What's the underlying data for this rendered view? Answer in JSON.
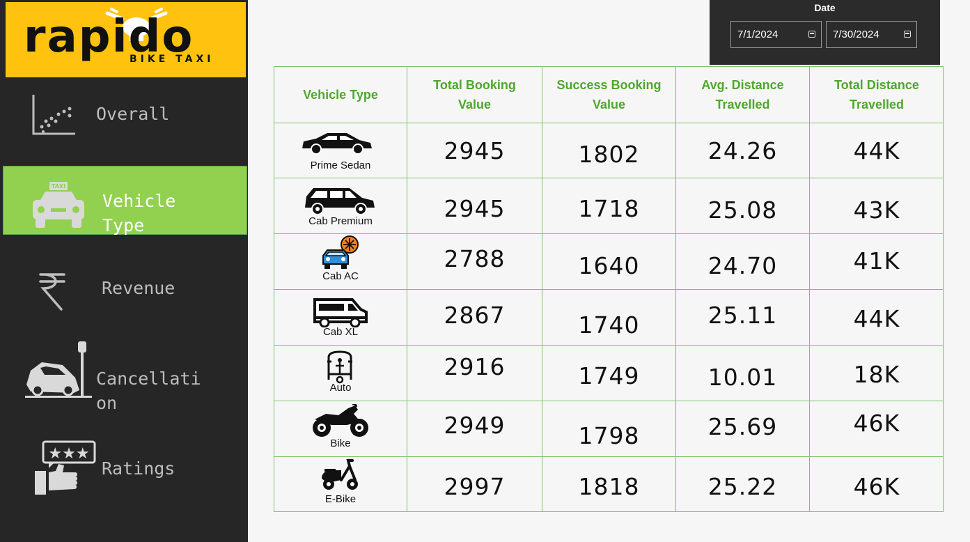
{
  "brand": {
    "name": "rapido",
    "tagline": "BIKE TAXI"
  },
  "sidebar": {
    "items": [
      {
        "label": "Overall",
        "icon": "scatter-chart-icon"
      },
      {
        "label_line1": "Vehicle",
        "label_line2": "Type",
        "icon": "taxi-icon",
        "active": true
      },
      {
        "label": "Revenue",
        "icon": "rupee-icon"
      },
      {
        "label_line1": "Cancellati",
        "label_line2": "on",
        "icon": "car-crash-icon"
      },
      {
        "label": "Ratings",
        "icon": "thumbs-up-stars-icon"
      }
    ]
  },
  "date_filter": {
    "title": "Date",
    "start": "7/1/2024",
    "end": "7/30/2024"
  },
  "table": {
    "headers": {
      "vehicle_type": "Vehicle Type",
      "total_booking_line1": "Total Booking",
      "total_booking_line2": "Value",
      "success_booking_line1": "Success Booking",
      "success_booking_line2": "Value",
      "avg_distance_line1": "Avg. Distance",
      "avg_distance_line2": "Travelled",
      "total_distance_line1": "Total Distance",
      "total_distance_line2": "Travelled"
    },
    "rows": [
      {
        "vehicle": "Prime Sedan",
        "icon": "sedan-icon",
        "total_booking": "2945",
        "success_booking": "1802",
        "avg_distance": "24.26",
        "total_distance": "44K"
      },
      {
        "vehicle": "Cab Premium",
        "icon": "suv-icon",
        "total_booking": "2945",
        "success_booking": "1718",
        "avg_distance": "25.08",
        "total_distance": "43K"
      },
      {
        "vehicle": "Cab AC",
        "icon": "car-ac-icon",
        "total_booking": "2788",
        "success_booking": "1640",
        "avg_distance": "24.70",
        "total_distance": "41K"
      },
      {
        "vehicle": "Cab XL",
        "icon": "van-icon",
        "total_booking": "2867",
        "success_booking": "1740",
        "avg_distance": "25.11",
        "total_distance": "44K"
      },
      {
        "vehicle": "Auto",
        "icon": "auto-rickshaw-icon",
        "total_booking": "2916",
        "success_booking": "1749",
        "avg_distance": "10.01",
        "total_distance": "18K"
      },
      {
        "vehicle": "Bike",
        "icon": "motorbike-icon",
        "total_booking": "2949",
        "success_booking": "1798",
        "avg_distance": "25.69",
        "total_distance": "46K"
      },
      {
        "vehicle": "E-Bike",
        "icon": "scooter-icon",
        "total_booking": "2997",
        "success_booking": "1818",
        "avg_distance": "25.22",
        "total_distance": "46K"
      }
    ]
  },
  "colors": {
    "accent_green": "#92d050",
    "header_green": "#4ea72e",
    "logo_yellow": "#ffc20e",
    "sidebar_bg": "#262626"
  }
}
